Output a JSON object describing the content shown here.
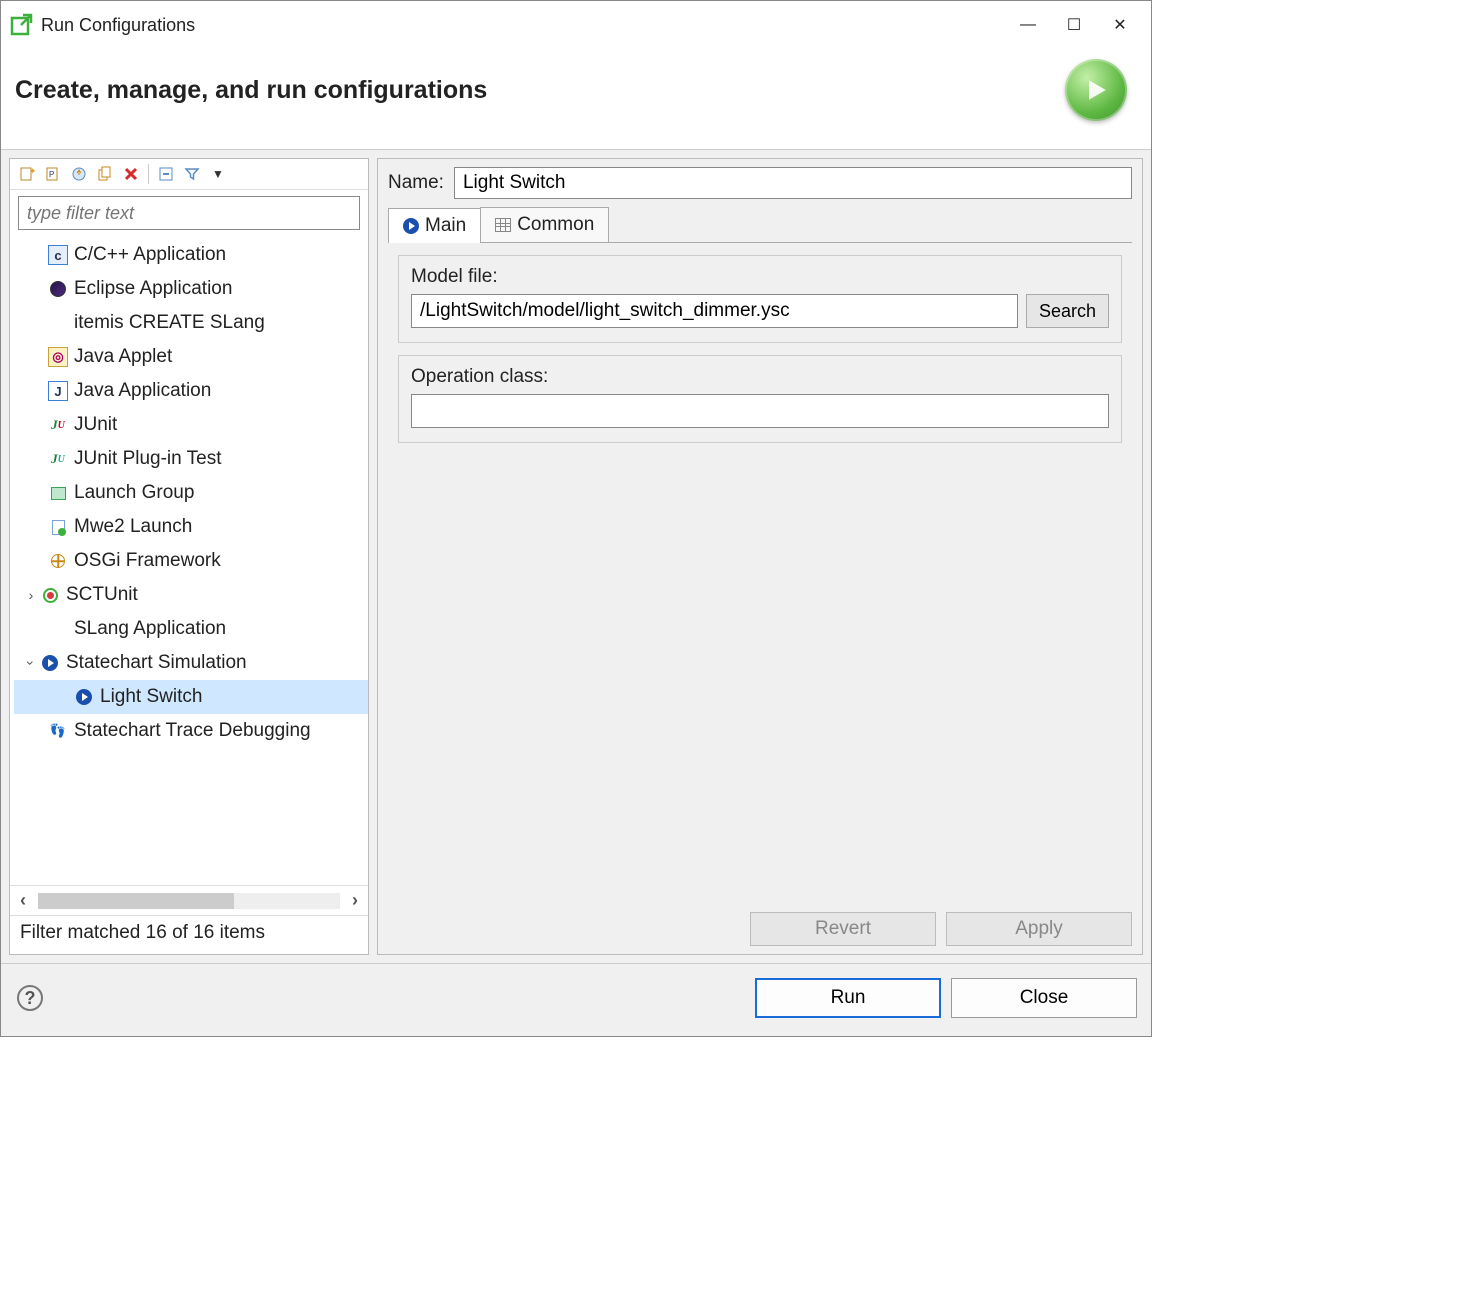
{
  "window": {
    "title": "Run Configurations",
    "header": "Create, manage, and run configurations"
  },
  "filter": {
    "placeholder": "type filter text"
  },
  "tree": [
    {
      "label": "C/C++ Application",
      "depth": 1,
      "icon": "c"
    },
    {
      "label": "Eclipse Application",
      "depth": 1,
      "icon": "ecl"
    },
    {
      "label": "itemis CREATE SLang",
      "depth": 1,
      "icon": ""
    },
    {
      "label": "Java Applet",
      "depth": 1,
      "icon": "jap"
    },
    {
      "label": "Java Application",
      "depth": 1,
      "icon": "j"
    },
    {
      "label": "JUnit",
      "depth": 1,
      "icon": "ju"
    },
    {
      "label": "JUnit Plug-in Test",
      "depth": 1,
      "icon": "jup"
    },
    {
      "label": "Launch Group",
      "depth": 1,
      "icon": "lg"
    },
    {
      "label": "Mwe2 Launch",
      "depth": 1,
      "icon": "mwe"
    },
    {
      "label": "OSGi Framework",
      "depth": 1,
      "icon": "osgi"
    },
    {
      "label": "SCTUnit",
      "depth": 0,
      "icon": "sct",
      "twisty": "closed"
    },
    {
      "label": "SLang Application",
      "depth": 1,
      "icon": ""
    },
    {
      "label": "Statechart Simulation",
      "depth": 0,
      "icon": "play",
      "twisty": "open"
    },
    {
      "label": "Light Switch",
      "depth": 2,
      "icon": "play",
      "selected": true
    },
    {
      "label": "Statechart Trace Debugging",
      "depth": 1,
      "icon": "feet"
    }
  ],
  "status": "Filter matched 16 of 16 items",
  "form": {
    "name_label": "Name:",
    "name_value": "Light Switch",
    "tabs": {
      "main": "Main",
      "common": "Common"
    },
    "model_file_label": "Model file:",
    "model_file_value": "/LightSwitch/model/light_switch_dimmer.ysc",
    "search_label": "Search",
    "operation_class_label": "Operation class:",
    "operation_class_value": ""
  },
  "buttons": {
    "revert": "Revert",
    "apply": "Apply",
    "run": "Run",
    "close": "Close"
  }
}
